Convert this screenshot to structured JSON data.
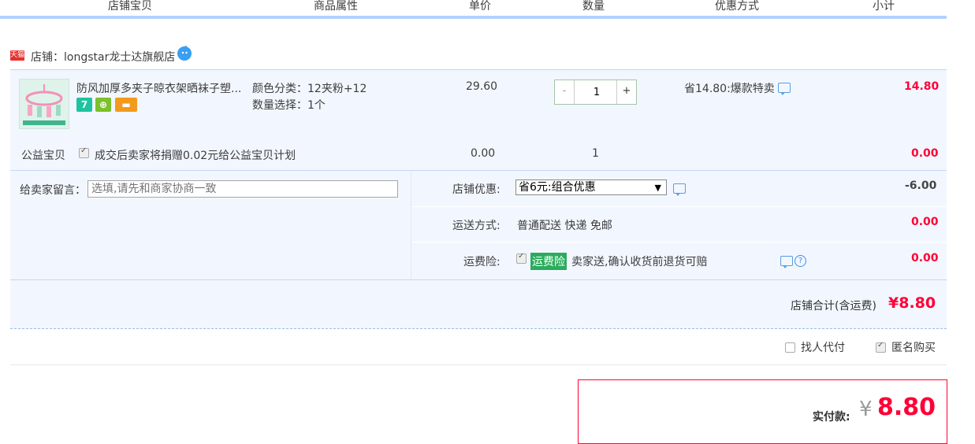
{
  "header": {
    "col_item": "店铺宝贝",
    "col_attr": "商品属性",
    "col_price": "单价",
    "col_qty": "数量",
    "col_discount": "优惠方式",
    "col_subtotal": "小计"
  },
  "shop": {
    "badge": "天猫",
    "label": "店铺：longstar龙士达旗舰店"
  },
  "item": {
    "title": "防风加厚多夹子晾衣架晒袜子塑...",
    "attr_color": "颜色分类：12夹粉+12",
    "attr_qty": "数量选择：1个",
    "price": "29.60",
    "quantity": "1",
    "minus": "-",
    "plus": "+",
    "discount": "省14.80:爆款特卖",
    "subtotal": "14.80",
    "badges": [
      {
        "text": "7",
        "color": "#1ec3a0"
      },
      {
        "text": "⊕",
        "color": "#7cc02c"
      },
      {
        "text": "▬",
        "color": "#f39a1c"
      }
    ]
  },
  "charity": {
    "label": "公益宝贝",
    "text": "成交后卖家将捐赠0.02元给公益宝贝计划",
    "price": "0.00",
    "qty": "1",
    "subtotal": "0.00"
  },
  "message": {
    "label": "给卖家留言：",
    "placeholder": "选填,请先和商家协商一致"
  },
  "shop_discount": {
    "label": "店铺优惠:",
    "selected": "省6元:组合优惠",
    "amount": "-6.00"
  },
  "shipping": {
    "label": "运送方式:",
    "text": "普通配送 快递 免邮",
    "amount": "0.00"
  },
  "insurance": {
    "label": "运费险:",
    "tag": "运费险",
    "text": "卖家送,确认收货前退货可赔",
    "amount": "0.00"
  },
  "shop_total": {
    "label": "店铺合计(含运费)",
    "amount": "¥8.80"
  },
  "options": {
    "proxy_pay": "找人代付",
    "anonymous": "匿名购买"
  },
  "payment": {
    "label": "实付款:",
    "currency": "¥",
    "amount": "8.80"
  }
}
